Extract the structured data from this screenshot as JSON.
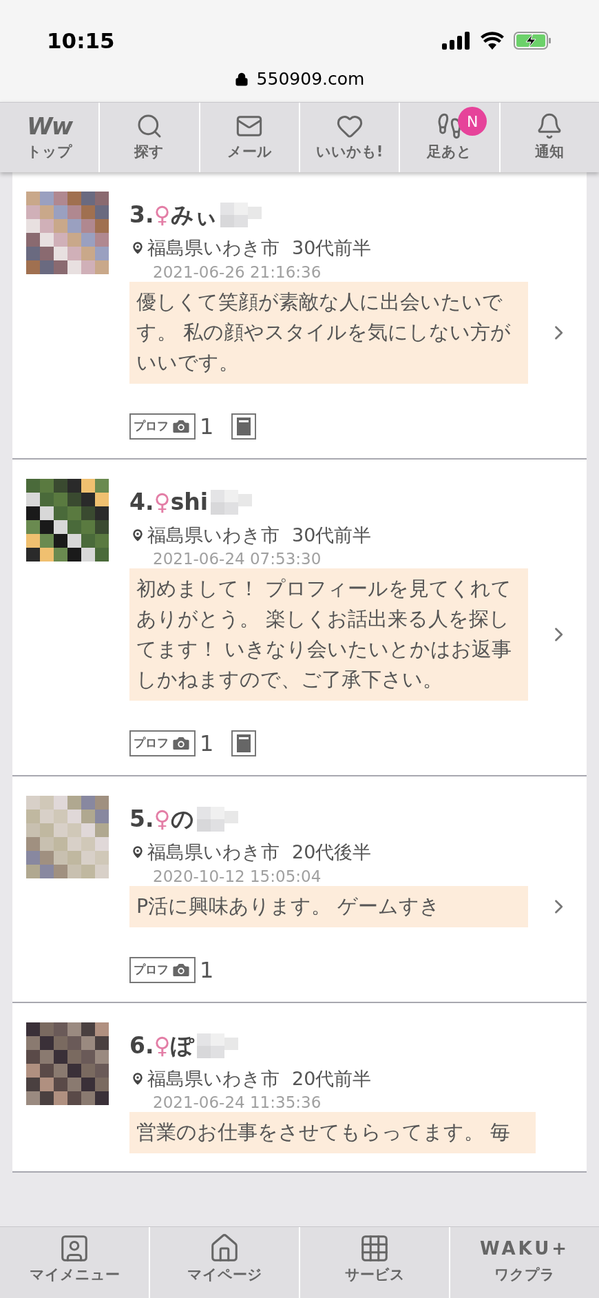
{
  "status_bar": {
    "time": "10:15"
  },
  "address_bar": {
    "url": "550909.com"
  },
  "top_nav": [
    {
      "kind": "logo",
      "logo": "Ww",
      "label": "トップ"
    },
    {
      "kind": "search",
      "label": "探す"
    },
    {
      "kind": "mail",
      "label": "メール"
    },
    {
      "kind": "heart",
      "label": "いいかも!"
    },
    {
      "kind": "footprints",
      "label": "足あと",
      "badge": "N"
    },
    {
      "kind": "bell",
      "label": "通知"
    }
  ],
  "users": [
    {
      "rank": "3.",
      "gender": "♀",
      "name": "みぃ",
      "location": "福島県いわき市",
      "age": "30代前半",
      "date": "2021-06-26 21:16:36",
      "message": "優しくて笑顔が素敵な人に出会いたいです。 私の顔やスタイルを気にしない方がいいです。",
      "profile_tag": "プロフ",
      "photo_count": "1",
      "memo": true
    },
    {
      "rank": "4.",
      "gender": "♀",
      "name": "shi",
      "location": "福島県いわき市",
      "age": "30代前半",
      "date": "2021-06-24 07:53:30",
      "message": "初めまして！ プロフィールを見てくれてありがとう。 楽しくお話出来る人を探してます！ いきなり会いたいとかはお返事しかねますので、ご了承下さい。",
      "profile_tag": "プロフ",
      "photo_count": "1",
      "memo": true
    },
    {
      "rank": "5.",
      "gender": "♀",
      "name": "の",
      "location": "福島県いわき市",
      "age": "20代後半",
      "date": "2020-10-12 15:05:04",
      "message": "P活に興味あります。 ゲームすき",
      "profile_tag": "プロフ",
      "photo_count": "1",
      "memo": false
    },
    {
      "rank": "6.",
      "gender": "♀",
      "name": "ぽ",
      "location": "福島県いわき市",
      "age": "20代前半",
      "date": "2021-06-24 11:35:36",
      "message": "営業のお仕事をさせてもらってます。 毎"
    }
  ],
  "bottom_nav": [
    {
      "kind": "person",
      "label": "マイメニュー"
    },
    {
      "kind": "house",
      "label": "マイページ"
    },
    {
      "kind": "grid",
      "label": "サービス"
    },
    {
      "kind": "logo",
      "logo": "WAKU+",
      "label": "ワクプラ"
    }
  ]
}
